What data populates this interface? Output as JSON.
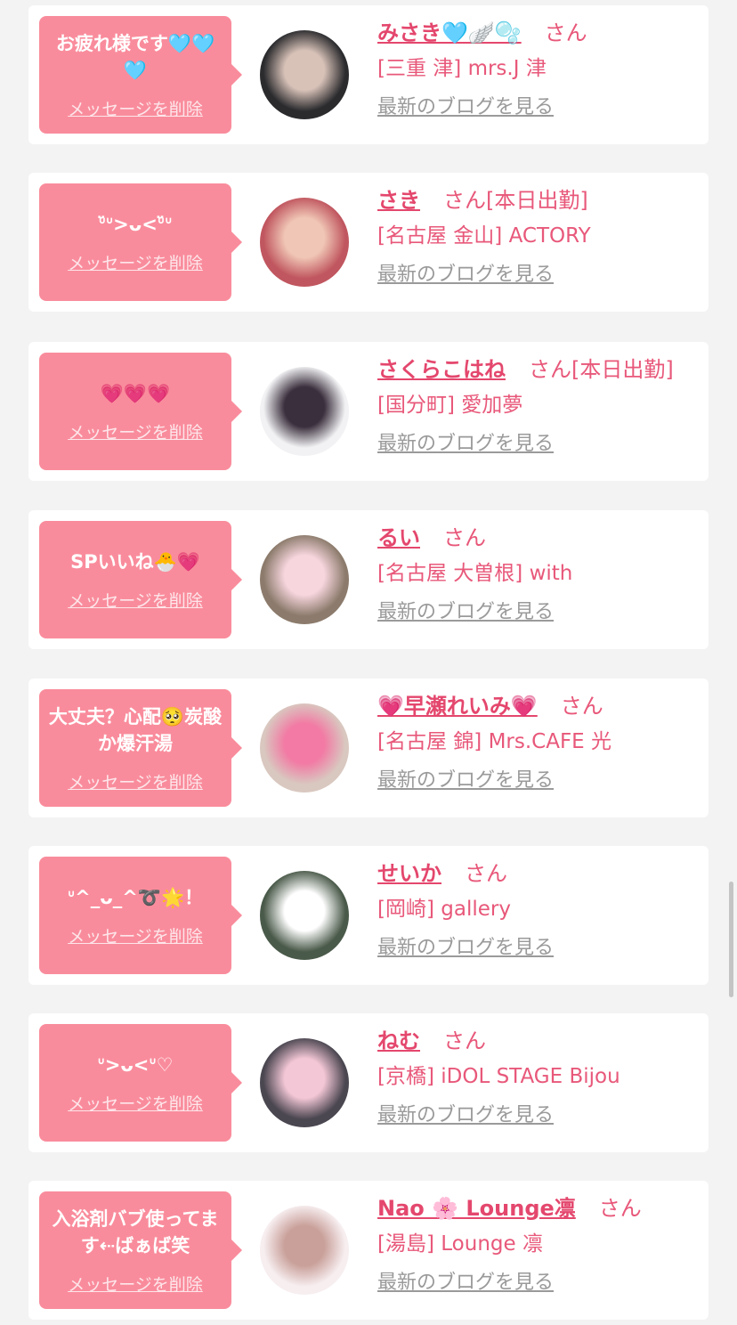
{
  "cards": [
    {
      "message": "お疲れ様です🩵🩵🩵",
      "delete_label": "メッセージを削除",
      "name": "みさき🩵🪽🫧",
      "san": "さん",
      "badge": "",
      "shop": "[三重 津] mrs.J 津",
      "blog_link": "最新のブログを見る",
      "avatar_colors": [
        "#2b2b2e",
        "#d8c2b8"
      ]
    },
    {
      "message": "ᐡ̆̈ᐡ>ᴗ<ᐡ̆̈ᐡ",
      "delete_label": "メッセージを削除",
      "name": "さき",
      "san": "さん",
      "badge": "[本日出勤]",
      "shop": "[名古屋 金山] ACTORY",
      "blog_link": "最新のブログを見る",
      "avatar_colors": [
        "#c0565f",
        "#f0c6b6"
      ]
    },
    {
      "message": "💗💗💗",
      "delete_label": "メッセージを削除",
      "name": "さくらこはね",
      "san": "さん",
      "badge": "[本日出勤]",
      "shop": "[国分町] 愛加夢",
      "blog_link": "最新のブログを見る",
      "avatar_colors": [
        "#f2f2f4",
        "#3a2f3d"
      ]
    },
    {
      "message": "SPいいね🐣💗",
      "delete_label": "メッセージを削除",
      "name": "るい",
      "san": "さん",
      "badge": "",
      "shop": "[名古屋 大曽根] with",
      "blog_link": "最新のブログを見る",
      "avatar_colors": [
        "#8c7b6c",
        "#f7d6de"
      ]
    },
    {
      "message": "大丈夫？心配🥺炭酸か爆汗湯",
      "delete_label": "メッセージを削除",
      "name": "💗早瀬れいみ💗",
      "san": "さん",
      "badge": "",
      "shop": "[名古屋 錦] Mrs.CAFE 光",
      "blog_link": "最新のブログを見る",
      "avatar_colors": [
        "#d9c8c0",
        "#f27aa4"
      ]
    },
    {
      "message": "ᐡ^_ᴗ_^➰🌟！",
      "delete_label": "メッセージを削除",
      "name": "せいか",
      "san": "さん",
      "badge": "",
      "shop": "[岡崎] gallery",
      "blog_link": "最新のブログを見る",
      "avatar_colors": [
        "#4a5a4a",
        "#ffffff"
      ]
    },
    {
      "message": "ᐡ>ᴗ<ᐡ♡",
      "delete_label": "メッセージを削除",
      "name": "ねむ",
      "san": "さん",
      "badge": "",
      "shop": "[京橋] iDOL STAGE Bijou",
      "blog_link": "最新のブログを見る",
      "avatar_colors": [
        "#4b4751",
        "#f4c7d6"
      ]
    },
    {
      "message": "入浴剤バブ使ってます⇠ばぁば笑",
      "delete_label": "メッセージを削除",
      "name": "Nao 🌸 Lounge凛",
      "san": "さん",
      "badge": "",
      "shop": "[湯島] Lounge 凛",
      "blog_link": "最新のブログを見る",
      "avatar_colors": [
        "#f7eef0",
        "#c9a09a"
      ]
    }
  ],
  "colors": {
    "bubble": "#f98c9c",
    "accent": "#e8587a",
    "background": "#f3f3f3"
  }
}
